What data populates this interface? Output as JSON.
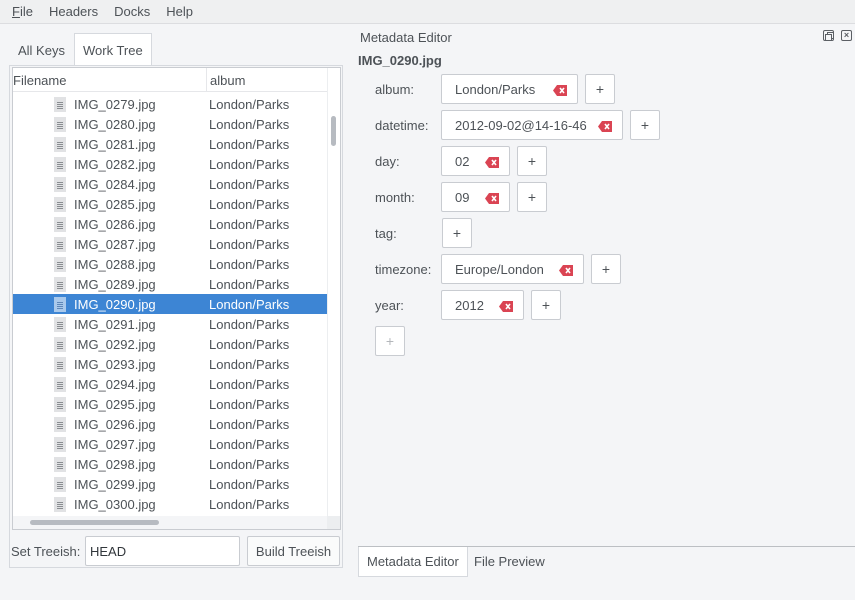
{
  "menu": [
    {
      "label": "File",
      "mnemonic": "F",
      "rest": "ile"
    },
    {
      "label": "Headers"
    },
    {
      "label": "Docks"
    },
    {
      "label": "Help"
    }
  ],
  "left_tabs": [
    {
      "label": "All Keys",
      "active": false
    },
    {
      "label": "Work Tree",
      "active": true
    }
  ],
  "tree": {
    "columns": [
      "Filename",
      "album"
    ],
    "rows": [
      {
        "filename": "IMG_0279.jpg",
        "album": "London/Parks"
      },
      {
        "filename": "IMG_0280.jpg",
        "album": "London/Parks"
      },
      {
        "filename": "IMG_0281.jpg",
        "album": "London/Parks"
      },
      {
        "filename": "IMG_0282.jpg",
        "album": "London/Parks"
      },
      {
        "filename": "IMG_0284.jpg",
        "album": "London/Parks"
      },
      {
        "filename": "IMG_0285.jpg",
        "album": "London/Parks"
      },
      {
        "filename": "IMG_0286.jpg",
        "album": "London/Parks"
      },
      {
        "filename": "IMG_0287.jpg",
        "album": "London/Parks"
      },
      {
        "filename": "IMG_0288.jpg",
        "album": "London/Parks"
      },
      {
        "filename": "IMG_0289.jpg",
        "album": "London/Parks"
      },
      {
        "filename": "IMG_0290.jpg",
        "album": "London/Parks",
        "selected": true
      },
      {
        "filename": "IMG_0291.jpg",
        "album": "London/Parks"
      },
      {
        "filename": "IMG_0292.jpg",
        "album": "London/Parks"
      },
      {
        "filename": "IMG_0293.jpg",
        "album": "London/Parks"
      },
      {
        "filename": "IMG_0294.jpg",
        "album": "London/Parks"
      },
      {
        "filename": "IMG_0295.jpg",
        "album": "London/Parks"
      },
      {
        "filename": "IMG_0296.jpg",
        "album": "London/Parks"
      },
      {
        "filename": "IMG_0297.jpg",
        "album": "London/Parks"
      },
      {
        "filename": "IMG_0298.jpg",
        "album": "London/Parks"
      },
      {
        "filename": "IMG_0299.jpg",
        "album": "London/Parks"
      },
      {
        "filename": "IMG_0300.jpg",
        "album": "London/Parks"
      }
    ],
    "row_icon": "file-text-icon"
  },
  "treeish": {
    "label": "Set Treeish:",
    "value": "HEAD",
    "button_label": "Build Treeish"
  },
  "metadata_editor": {
    "dock_title": "Metadata Editor",
    "file_name": "IMG_0290.jpg",
    "fields": [
      {
        "key": "album:",
        "values": [
          "London/Parks"
        ]
      },
      {
        "key": "datetime:",
        "values": [
          "2012-09-02@14-16-46"
        ]
      },
      {
        "key": "day:",
        "values": [
          "02"
        ]
      },
      {
        "key": "month:",
        "values": [
          "09"
        ]
      },
      {
        "key": "tag:",
        "values": []
      },
      {
        "key": "timezone:",
        "values": [
          "Europe/London"
        ]
      },
      {
        "key": "year:",
        "values": [
          "2012"
        ]
      }
    ],
    "add_label": "+",
    "clear_icon": "backspace-clear-icon",
    "clear_color": "#da4453"
  },
  "bottom_tabs": [
    {
      "label": "Metadata Editor",
      "active": true
    },
    {
      "label": "File Preview",
      "active": false
    }
  ],
  "colors": {
    "selection": "#3d85d4",
    "background": "#f4f5f7"
  }
}
